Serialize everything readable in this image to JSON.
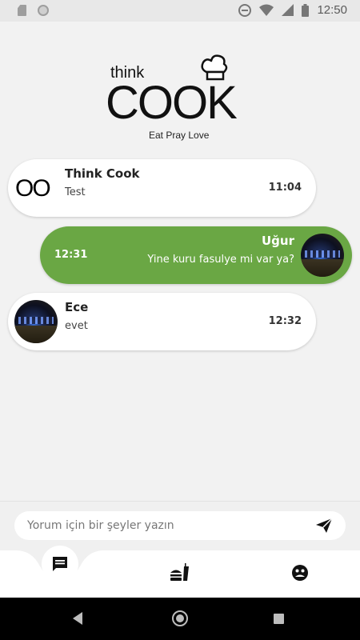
{
  "status_bar": {
    "time": "12:50"
  },
  "logo": {
    "think": "think",
    "cook": "COOK",
    "tagline": "Eat Pray Love"
  },
  "messages": [
    {
      "name": "Think Cook",
      "text": "Test",
      "time": "11:04",
      "avatar": "think-cook-logo"
    },
    {
      "name": "Uğur",
      "text": "Yine kuru fasulye mi var ya?",
      "time": "12:31",
      "avatar": "night-city-photo"
    },
    {
      "name": "Ece",
      "text": "evet",
      "time": "12:32",
      "avatar": "night-city-photo"
    }
  ],
  "composer": {
    "placeholder": "Yorum için bir şeyler yazın",
    "send_icon": "send-icon"
  },
  "bottom_nav": [
    "chat-icon",
    "fastfood-icon",
    "profile-icon"
  ],
  "colors": {
    "accent_green": "#6aa744",
    "background": "#f2f2f2"
  }
}
